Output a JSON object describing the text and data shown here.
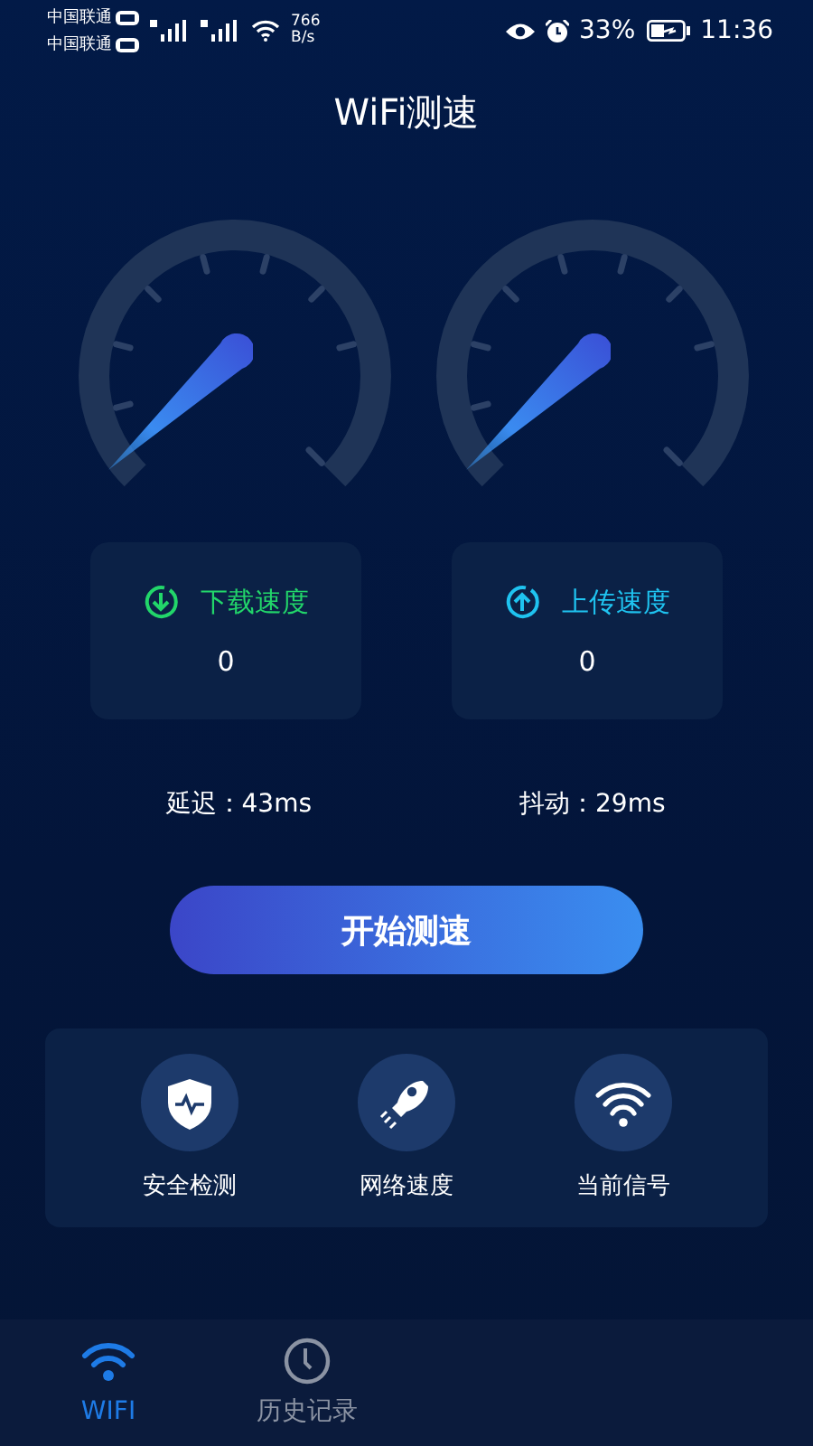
{
  "status_bar": {
    "carriers": [
      "中国联通",
      "中国联通"
    ],
    "net_speed": [
      "766",
      "B/s"
    ],
    "battery_percent": "33%",
    "time": "11:36"
  },
  "title": "WiFi测速",
  "speed_cards": [
    {
      "kind": "download",
      "label": "下载速度",
      "value": "0",
      "color": "#22d66a"
    },
    {
      "kind": "upload",
      "label": "上传速度",
      "value": "0",
      "color": "#1fc3f0"
    }
  ],
  "stats": [
    "延迟：43ms",
    "抖动：29ms"
  ],
  "start_button": "开始测速",
  "features": [
    {
      "kind": "security",
      "label": "安全检测"
    },
    {
      "kind": "speed",
      "label": "网络速度"
    },
    {
      "kind": "signal",
      "label": "当前信号"
    }
  ],
  "nav": [
    {
      "kind": "wifi",
      "label": "WIFI",
      "selected": true
    },
    {
      "kind": "history",
      "label": "历史记录",
      "selected": false
    }
  ]
}
